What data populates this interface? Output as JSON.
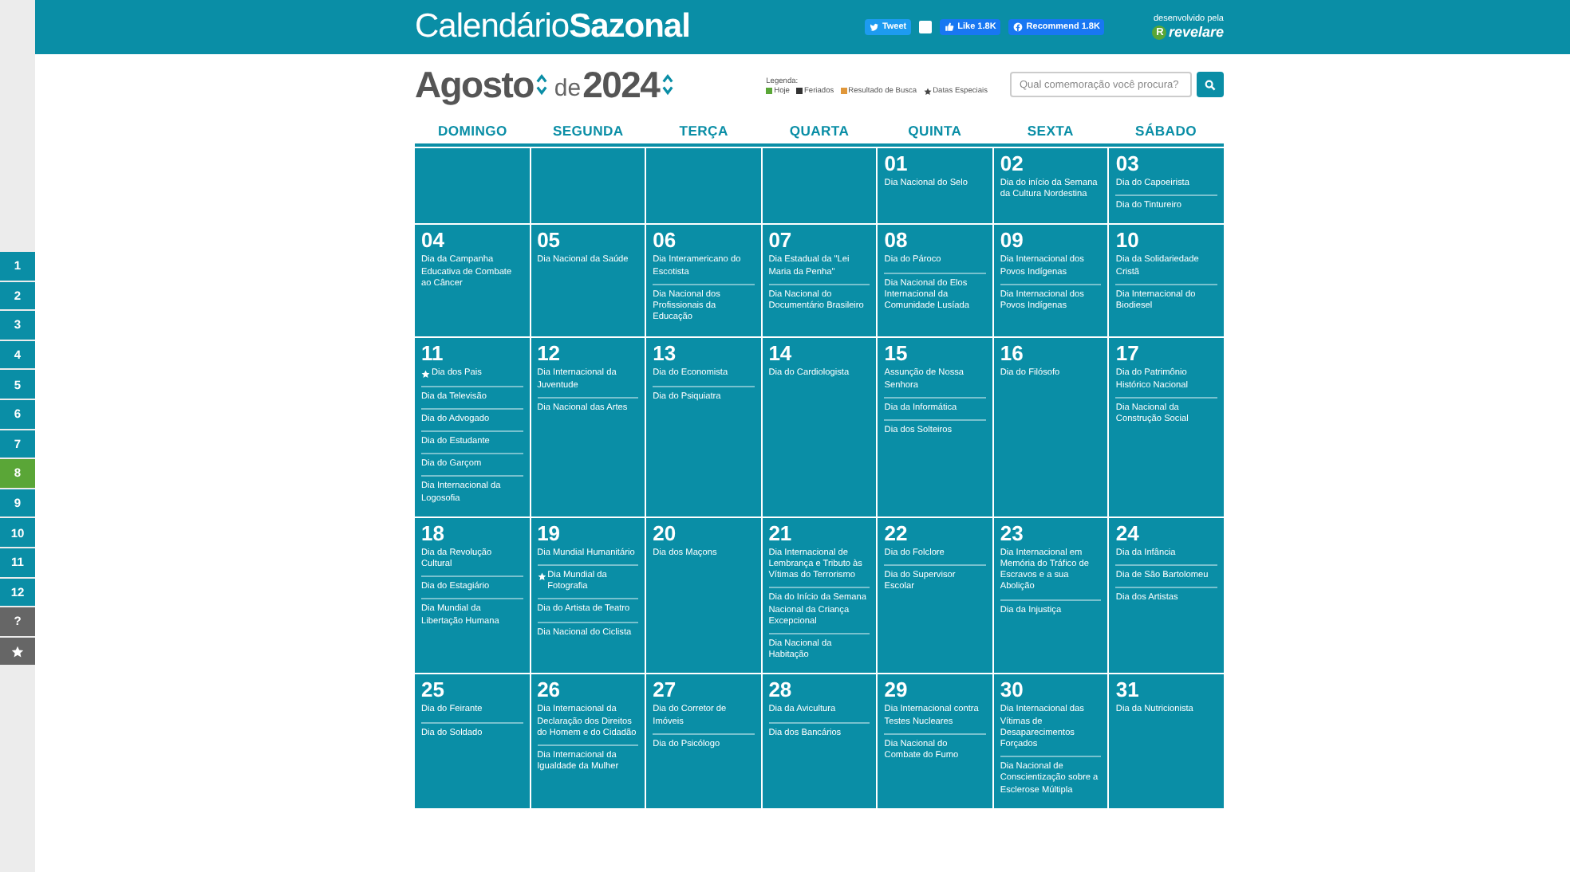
{
  "header": {
    "logo": {
      "light": "Calendário",
      "bold": "Sazonal"
    },
    "social": [
      {
        "kind": "tweet",
        "label": "Tweet"
      },
      {
        "kind": "counter"
      },
      {
        "kind": "like",
        "label": "Like 1.8K"
      },
      {
        "kind": "recommend",
        "label": "Recommend 1.8K"
      }
    ],
    "credit": {
      "caption": "desenvolvido pela",
      "mark": "R",
      "brand": "revelare"
    }
  },
  "sidebar": {
    "items": [
      {
        "kind": "month",
        "label": "1",
        "selected": false
      },
      {
        "kind": "month",
        "label": "2",
        "selected": false
      },
      {
        "kind": "month",
        "label": "3",
        "selected": false
      },
      {
        "kind": "month",
        "label": "4",
        "selected": false
      },
      {
        "kind": "month",
        "label": "5",
        "selected": false
      },
      {
        "kind": "month",
        "label": "6",
        "selected": false
      },
      {
        "kind": "month",
        "label": "7",
        "selected": false
      },
      {
        "kind": "month",
        "label": "8",
        "selected": true
      },
      {
        "kind": "month",
        "label": "9",
        "selected": false
      },
      {
        "kind": "month",
        "label": "10",
        "selected": false
      },
      {
        "kind": "month",
        "label": "11",
        "selected": false
      },
      {
        "kind": "month",
        "label": "12",
        "selected": false
      },
      {
        "kind": "other",
        "label": "?",
        "selected": false
      },
      {
        "kind": "favorites",
        "selected": false
      }
    ]
  },
  "toolbar": {
    "month": "Agosto",
    "joiner": "de",
    "year": "2024",
    "legend": {
      "title": "Legenda:",
      "items": [
        {
          "kind": "swatch",
          "label": "Hoje",
          "color": "#5aa637"
        },
        {
          "kind": "swatch",
          "label": "Feriados",
          "color": "#333333"
        },
        {
          "kind": "swatch",
          "label": "Resultado de Busca",
          "color": "#e0973a"
        },
        {
          "kind": "star",
          "label": "Datas Especiais"
        }
      ]
    },
    "search": {
      "placeholder": "Qual comemoração você procura?"
    }
  },
  "weekdays": [
    "DOMINGO",
    "SEGUNDA",
    "TERÇA",
    "QUARTA",
    "QUINTA",
    "SEXTA",
    "SÁBADO"
  ],
  "weeks": [
    {
      "days": [
        {
          "kind": "empty"
        },
        {
          "kind": "empty"
        },
        {
          "kind": "empty"
        },
        {
          "kind": "empty"
        },
        {
          "kind": "day",
          "day": "01",
          "events": [
            {
              "text": "Dia Nacional do Selo",
              "special": false
            }
          ]
        },
        {
          "kind": "day",
          "day": "02",
          "events": [
            {
              "text": "Dia do início da Semana da Cultura Nordestina",
              "special": false
            }
          ]
        },
        {
          "kind": "day",
          "day": "03",
          "events": [
            {
              "text": "Dia do Capoeirista",
              "special": false
            },
            {
              "text": "Dia do Tintureiro",
              "special": false
            }
          ]
        }
      ]
    },
    {
      "days": [
        {
          "kind": "day",
          "day": "04",
          "events": [
            {
              "text": "Dia da Campanha Educativa de Combate ao Câncer",
              "special": false
            }
          ]
        },
        {
          "kind": "day",
          "day": "05",
          "events": [
            {
              "text": "Dia Nacional da Saúde",
              "special": false
            }
          ]
        },
        {
          "kind": "day",
          "day": "06",
          "events": [
            {
              "text": "Dia Interamericano do Escotista",
              "special": false
            },
            {
              "text": "Dia Nacional dos Profissionais da Educação",
              "special": false
            }
          ]
        },
        {
          "kind": "day",
          "day": "07",
          "events": [
            {
              "text": "Dia Estadual da \"Lei Maria da Penha\"",
              "special": false
            },
            {
              "text": "Dia Nacional do Documentário Brasileiro",
              "special": false
            }
          ]
        },
        {
          "kind": "day",
          "day": "08",
          "events": [
            {
              "text": "Dia do Pároco",
              "special": false
            },
            {
              "text": "Dia Nacional do Elos Internacional da Comunidade Lusíada",
              "special": false
            }
          ]
        },
        {
          "kind": "day",
          "day": "09",
          "events": [
            {
              "text": "Dia Internacional dos Povos Indígenas",
              "special": false
            },
            {
              "text": "Dia Internacional dos Povos Indígenas",
              "special": false
            }
          ]
        },
        {
          "kind": "day",
          "day": "10",
          "events": [
            {
              "text": "Dia da Solidariedade Cristã",
              "special": false
            },
            {
              "text": "Dia Internacional do Biodiesel",
              "special": false
            }
          ]
        }
      ]
    },
    {
      "days": [
        {
          "kind": "day",
          "day": "11",
          "events": [
            {
              "text": "Dia dos Pais",
              "special": true
            },
            {
              "text": "Dia da Televisão",
              "special": false
            },
            {
              "text": "Dia do Advogado",
              "special": false
            },
            {
              "text": "Dia do Estudante",
              "special": false
            },
            {
              "text": "Dia do Garçom",
              "special": false
            },
            {
              "text": "Dia Internacional da Logosofia",
              "special": false
            }
          ]
        },
        {
          "kind": "day",
          "day": "12",
          "events": [
            {
              "text": "Dia Internacional da Juventude",
              "special": false
            },
            {
              "text": "Dia Nacional das Artes",
              "special": false
            }
          ]
        },
        {
          "kind": "day",
          "day": "13",
          "events": [
            {
              "text": "Dia do Economista",
              "special": false
            },
            {
              "text": "Dia do Psiquiatra",
              "special": false
            }
          ]
        },
        {
          "kind": "day",
          "day": "14",
          "events": [
            {
              "text": "Dia do Cardiologista",
              "special": false
            }
          ]
        },
        {
          "kind": "day",
          "day": "15",
          "events": [
            {
              "text": "Assunção de Nossa Senhora",
              "special": false
            },
            {
              "text": "Dia da Informática",
              "special": false
            },
            {
              "text": "Dia dos Solteiros",
              "special": false
            }
          ]
        },
        {
          "kind": "day",
          "day": "16",
          "events": [
            {
              "text": "Dia do Filósofo",
              "special": false
            }
          ]
        },
        {
          "kind": "day",
          "day": "17",
          "events": [
            {
              "text": "Dia do Patrimônio Histórico Nacional",
              "special": false
            },
            {
              "text": "Dia Nacional da Construção Social",
              "special": false
            }
          ]
        }
      ]
    },
    {
      "days": [
        {
          "kind": "day",
          "day": "18",
          "events": [
            {
              "text": "Dia da Revolução Cultural",
              "special": false
            },
            {
              "text": "Dia do Estagiário",
              "special": false
            },
            {
              "text": "Dia Mundial da Libertação Humana",
              "special": false
            }
          ]
        },
        {
          "kind": "day",
          "day": "19",
          "events": [
            {
              "text": "Dia Mundial Humanitário",
              "special": false
            },
            {
              "text": "Dia Mundial da Fotografia",
              "special": true
            },
            {
              "text": "Dia do Artista de Teatro",
              "special": false
            },
            {
              "text": "Dia Nacional do Ciclista",
              "special": false
            }
          ]
        },
        {
          "kind": "day",
          "day": "20",
          "events": [
            {
              "text": "Dia dos Maçons",
              "special": false
            }
          ]
        },
        {
          "kind": "day",
          "day": "21",
          "events": [
            {
              "text": "Dia Internacional de Lembrança e Tributo às Vítimas do Terrorismo",
              "special": false
            },
            {
              "text": "Dia do Início da Semana Nacional da Criança Excepcional",
              "special": false
            },
            {
              "text": "Dia Nacional da Habitação",
              "special": false
            }
          ]
        },
        {
          "kind": "day",
          "day": "22",
          "events": [
            {
              "text": "Dia do Folclore",
              "special": false
            },
            {
              "text": "Dia do Supervisor Escolar",
              "special": false
            }
          ]
        },
        {
          "kind": "day",
          "day": "23",
          "events": [
            {
              "text": "Dia Internacional em Memória do Tráfico de Escravos e a sua Abolição",
              "special": false
            },
            {
              "text": "Dia da Injustiça",
              "special": false
            }
          ]
        },
        {
          "kind": "day",
          "day": "24",
          "events": [
            {
              "text": "Dia da Infância",
              "special": false
            },
            {
              "text": "Dia de São Bartolomeu",
              "special": false
            },
            {
              "text": "Dia dos Artistas",
              "special": false
            }
          ]
        }
      ]
    },
    {
      "days": [
        {
          "kind": "day",
          "day": "25",
          "events": [
            {
              "text": "Dia do Feirante",
              "special": false
            },
            {
              "text": "Dia do Soldado",
              "special": false
            }
          ]
        },
        {
          "kind": "day",
          "day": "26",
          "events": [
            {
              "text": "Dia Internacional da Declaração dos Direitos do Homem e do Cidadão",
              "special": false
            },
            {
              "text": "Dia Internacional da Igualdade da Mulher",
              "special": false
            }
          ]
        },
        {
          "kind": "day",
          "day": "27",
          "events": [
            {
              "text": "Dia do Corretor de Imóveis",
              "special": false
            },
            {
              "text": "Dia do Psicólogo",
              "special": false
            }
          ]
        },
        {
          "kind": "day",
          "day": "28",
          "events": [
            {
              "text": "Dia da Avicultura",
              "special": false
            },
            {
              "text": "Dia dos Bancários",
              "special": false
            }
          ]
        },
        {
          "kind": "day",
          "day": "29",
          "events": [
            {
              "text": "Dia Internacional contra Testes Nucleares",
              "special": false
            },
            {
              "text": "Dia Nacional do Combate do Fumo",
              "special": false
            }
          ]
        },
        {
          "kind": "day",
          "day": "30",
          "events": [
            {
              "text": "Dia Internacional das Vítimas de Desaparecimentos Forçados",
              "special": false
            },
            {
              "text": "Dia Nacional de Conscientização sobre a Esclerose Múltipla",
              "special": false
            }
          ]
        },
        {
          "kind": "day",
          "day": "31",
          "events": [
            {
              "text": "Dia da Nutricionista",
              "special": false
            }
          ]
        }
      ]
    }
  ]
}
